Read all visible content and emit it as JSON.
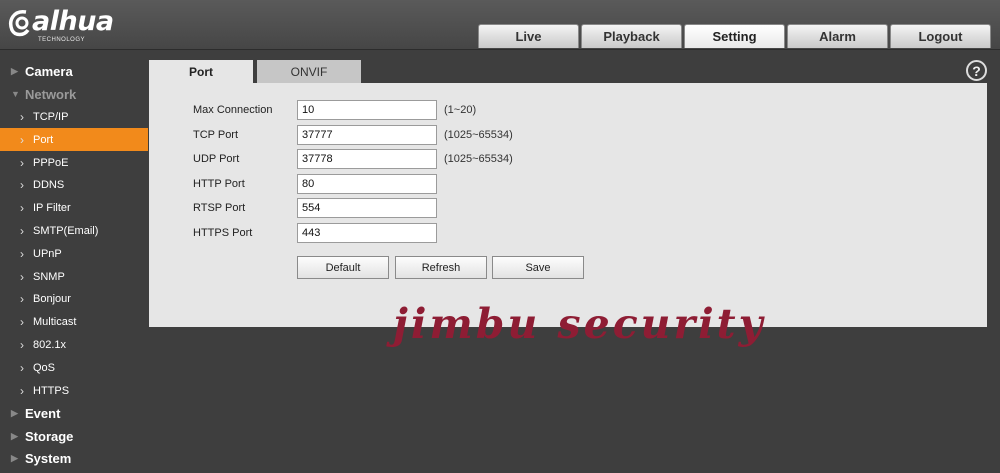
{
  "brand": {
    "name": "alhua",
    "sub": "TECHNOLOGY"
  },
  "topnav": [
    "Live",
    "Playback",
    "Setting",
    "Alarm",
    "Logout"
  ],
  "sidebar": {
    "camera": "Camera",
    "network": "Network",
    "items": [
      "TCP/IP",
      "Port",
      "PPPoE",
      "DDNS",
      "IP Filter",
      "SMTP(Email)",
      "UPnP",
      "SNMP",
      "Bonjour",
      "Multicast",
      "802.1x",
      "QoS",
      "HTTPS"
    ],
    "event": "Event",
    "storage": "Storage",
    "system": "System"
  },
  "tabs": {
    "port": "Port",
    "onvif": "ONVIF"
  },
  "form": {
    "max_connection": {
      "label": "Max Connection",
      "value": "10",
      "range": "(1~20)"
    },
    "tcp_port": {
      "label": "TCP Port",
      "value": "37777",
      "range": "(1025~65534)"
    },
    "udp_port": {
      "label": "UDP Port",
      "value": "37778",
      "range": "(1025~65534)"
    },
    "http_port": {
      "label": "HTTP Port",
      "value": "80"
    },
    "rtsp_port": {
      "label": "RTSP Port",
      "value": "554"
    },
    "https_port": {
      "label": "HTTPS Port",
      "value": "443"
    }
  },
  "buttons": {
    "default": "Default",
    "refresh": "Refresh",
    "save": "Save"
  },
  "help": "?",
  "watermark": "jimbu security",
  "colors": {
    "accent": "#f28a1b",
    "watermark": "#8e1d34",
    "background": "#3e3e3e"
  }
}
